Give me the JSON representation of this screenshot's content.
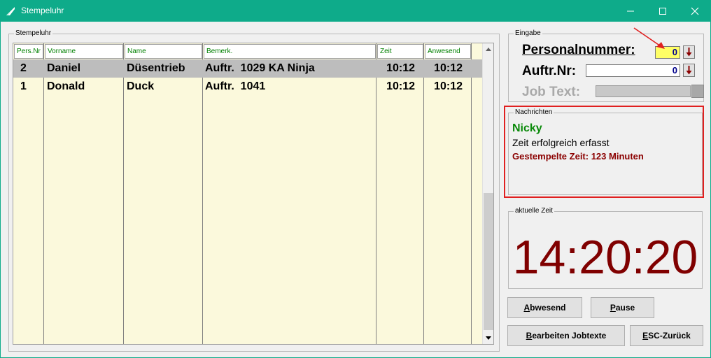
{
  "window": {
    "title": "Stempeluhr"
  },
  "stempeluhr": {
    "legend": "Stempeluhr",
    "columns": [
      "Pers.Nr",
      "Vorname",
      "Name",
      "Bemerk.",
      "Zeit",
      "Anwesend"
    ],
    "rows": [
      {
        "persnr": "2",
        "vorname": "Daniel",
        "name": "Düsentrieb",
        "bemerk": "Auftr.  1029 KA Ninja",
        "zeit": "10:12",
        "anwesend": "10:12",
        "selected": true
      },
      {
        "persnr": "1",
        "vorname": "Donald",
        "name": "Duck",
        "bemerk": "Auftr.  1041",
        "zeit": "10:12",
        "anwesend": "10:12",
        "selected": false
      }
    ]
  },
  "eingabe": {
    "legend": "Eingabe",
    "personalnummer_label": "Personalnummer:",
    "personalnummer_value": "0",
    "auftrnr_label": "Auftr.Nr:",
    "auftrnr_value": "0",
    "jobtext_label": "Job Text:"
  },
  "nachrichten": {
    "legend": "Nachrichten",
    "name": "Nicky",
    "line": "Zeit erfolgreich erfasst",
    "time": "Gestempelte Zeit: 123 Minuten"
  },
  "zeit": {
    "legend": "aktuelle Zeit",
    "value": "14:20:20"
  },
  "buttons": {
    "abwesend": "Abwesend",
    "pause": "Pause",
    "bearbeiten": "Bearbeiten Jobtexte",
    "zurueck": "ESC-Zurück"
  },
  "colors": {
    "titlebar": "#0eab8a",
    "grid_bg": "#fbf9dc",
    "header_text": "#008000",
    "clock": "#800000",
    "highlight": "#e02020"
  },
  "icons": [
    "app-icon",
    "minimize-icon",
    "maximize-icon",
    "close-icon",
    "spin-down-icon",
    "scroll-up-icon",
    "scroll-down-icon",
    "annotation-arrow-icon"
  ]
}
